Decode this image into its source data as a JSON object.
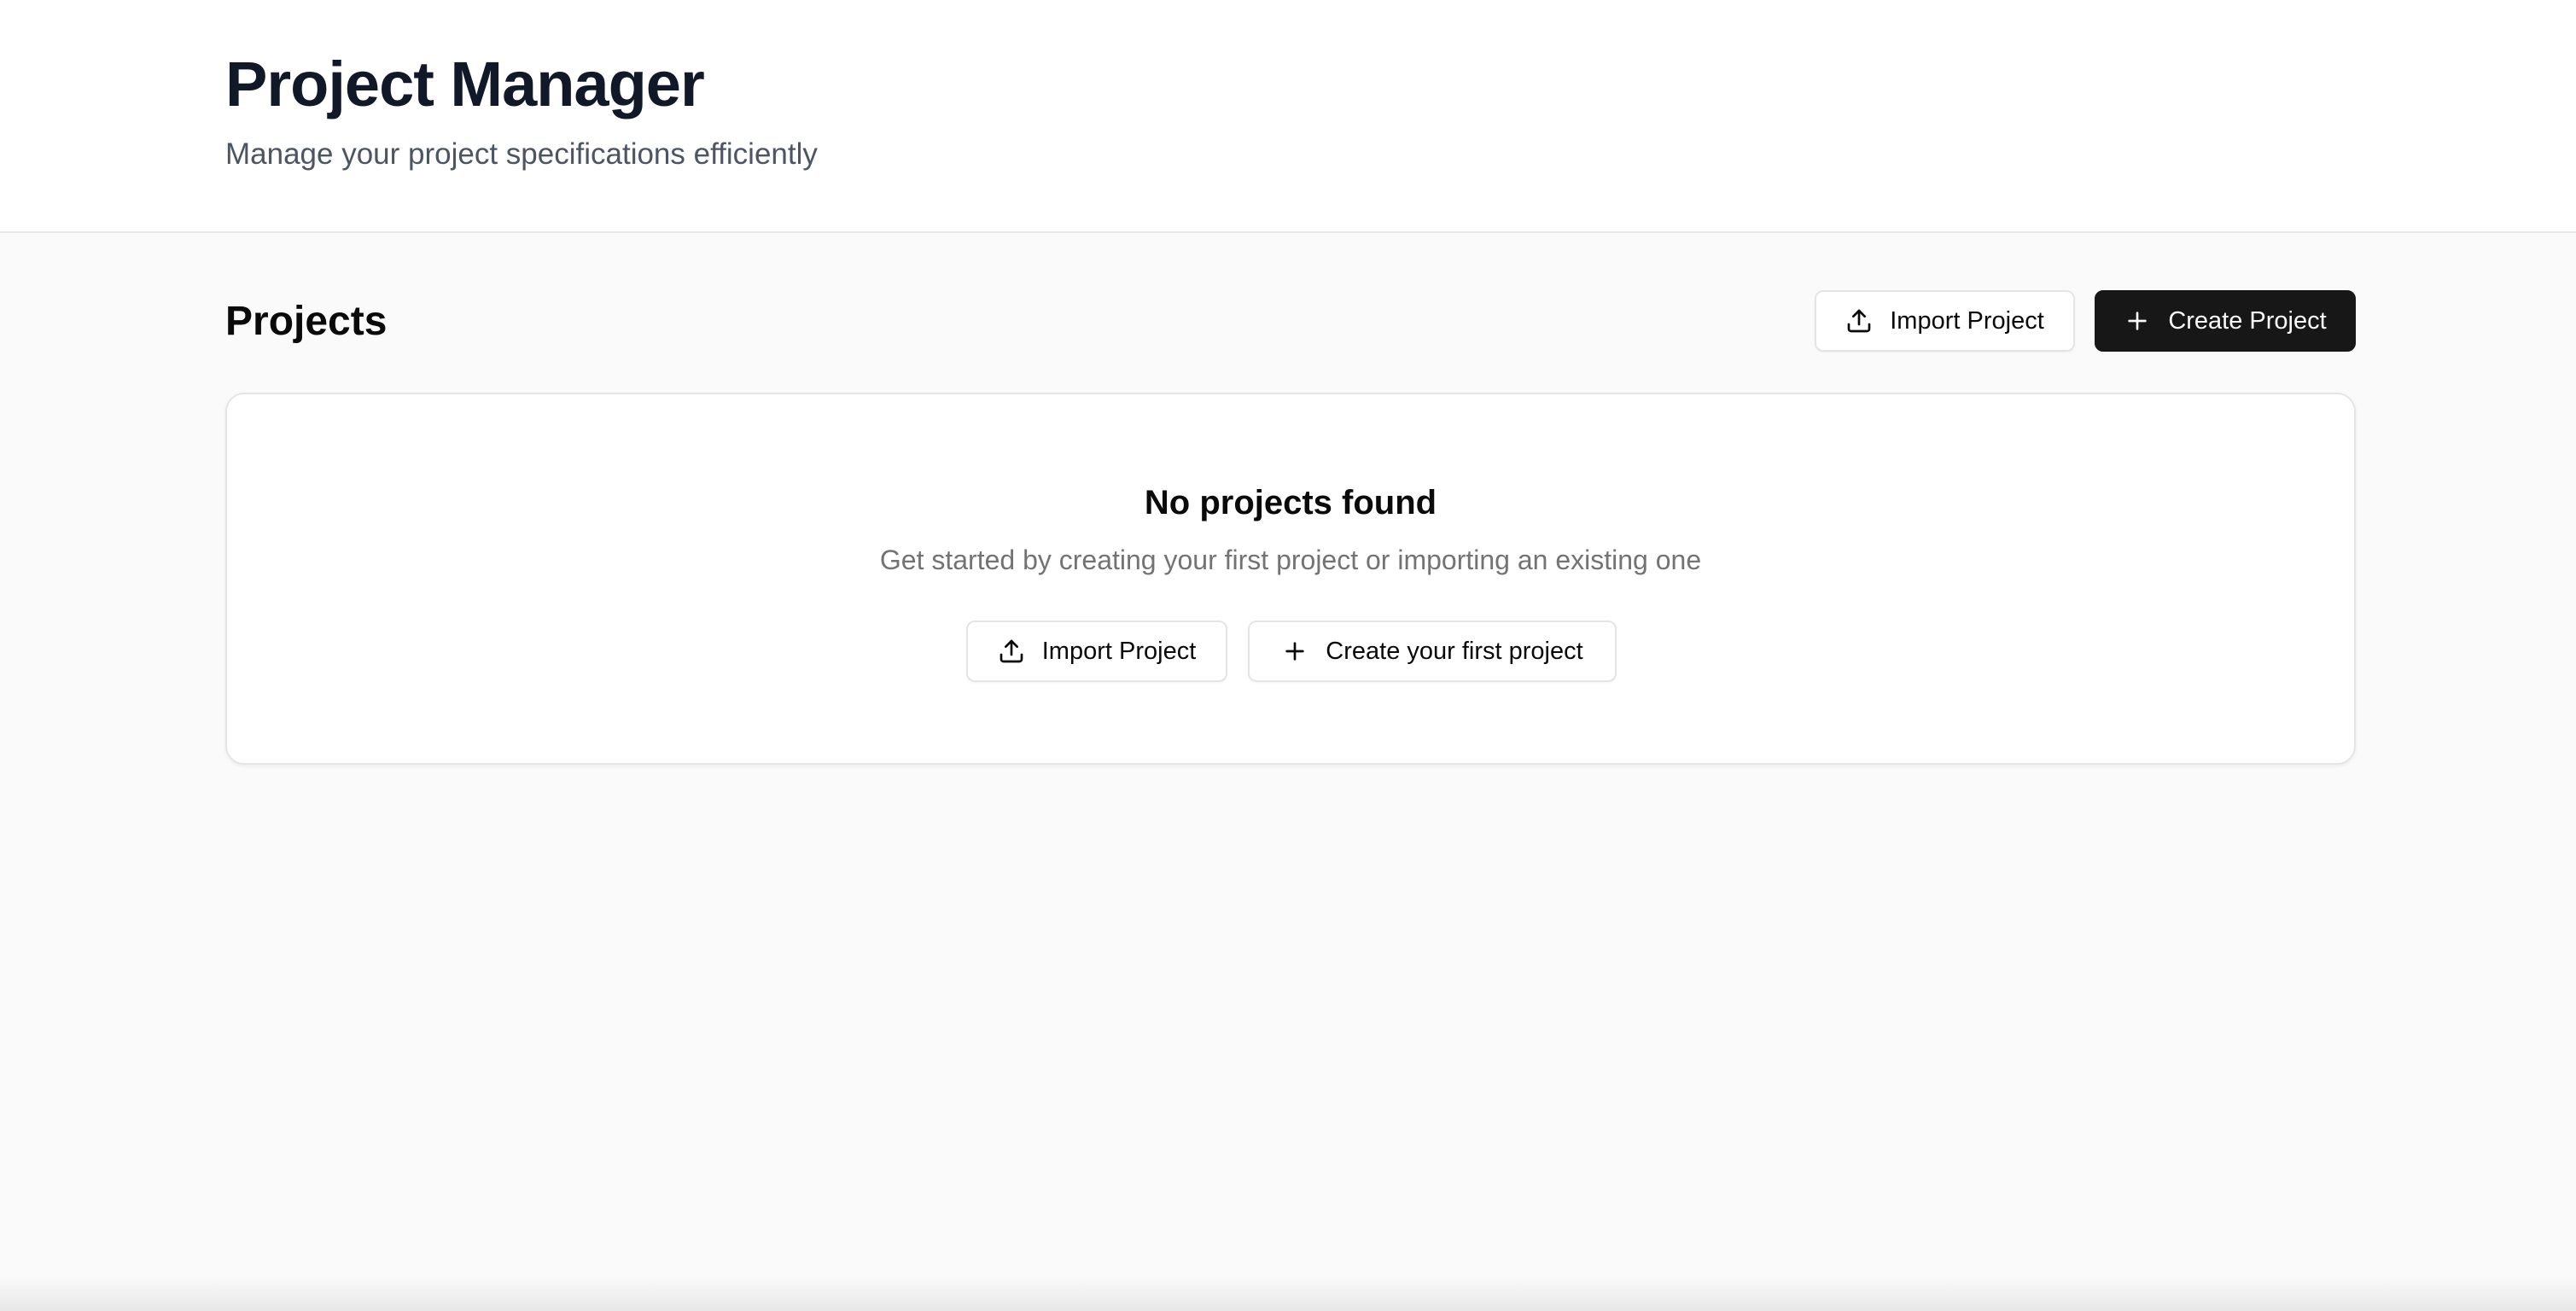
{
  "header": {
    "title": "Project Manager",
    "subtitle": "Manage your project specifications efficiently"
  },
  "projects": {
    "title": "Projects",
    "import_label": "Import Project",
    "create_label": "Create Project"
  },
  "empty_state": {
    "title": "No projects found",
    "description": "Get started by creating your first project or importing an existing one",
    "import_label": "Import Project",
    "create_label": "Create your first project"
  },
  "icons": {
    "import": "upload-icon",
    "create": "plus-icon"
  },
  "colors": {
    "primary_button": "#171717",
    "page_background": "#fafafa"
  }
}
